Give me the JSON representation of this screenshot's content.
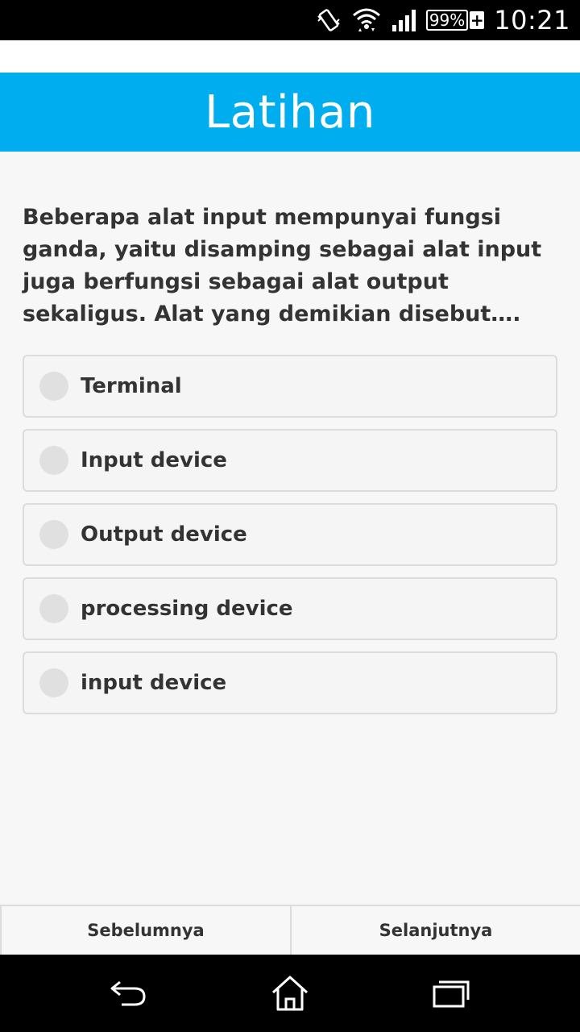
{
  "status_bar": {
    "battery": "99%",
    "battery_charging": "+",
    "time": "10:21",
    "icons": [
      "vibrate-icon",
      "wifi-icon",
      "signal-icon",
      "battery-icon"
    ]
  },
  "header": {
    "title": "Latihan"
  },
  "quiz": {
    "question": "Beberapa alat input mempunyai fungsi ganda, yaitu disamping sebagai alat input juga berfungsi sebagai alat output sekaligus. Alat yang demikian disebut….",
    "options": [
      {
        "label": "Terminal"
      },
      {
        "label": "Input device"
      },
      {
        "label": "Output device"
      },
      {
        "label": "processing device"
      },
      {
        "label": "input device"
      }
    ]
  },
  "navigation": {
    "prev_label": "Sebelumnya",
    "next_label": "Selanjutnya"
  },
  "system_nav": {
    "icons": [
      "back-icon",
      "home-icon",
      "recents-icon"
    ]
  },
  "colors": {
    "header_bg": "#00aeef",
    "text": "#333333",
    "option_border": "#dcdcdc",
    "radio": "#e0e0e0"
  }
}
